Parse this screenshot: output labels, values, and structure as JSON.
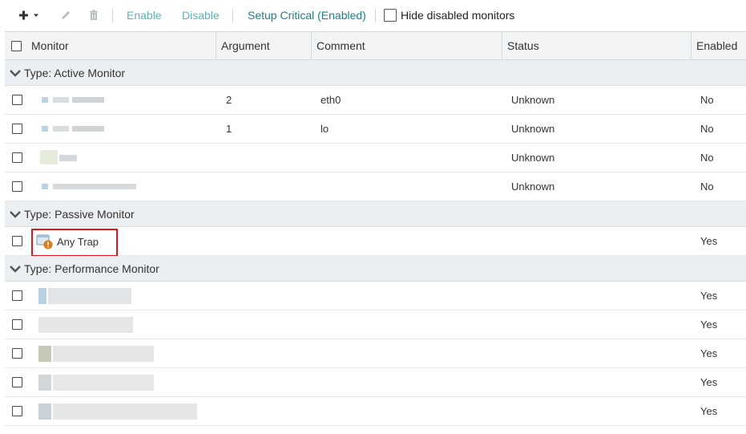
{
  "toolbar": {
    "add_icon": "plus-icon",
    "dropdown_icon": "caret-down-icon",
    "edit_icon": "pencil-icon",
    "delete_icon": "trash-icon",
    "enable_label": "Enable",
    "disable_label": "Disable",
    "setup_critical_label": "Setup Critical (Enabled)",
    "hide_disabled_label": "Hide disabled monitors",
    "hide_disabled_checked": false
  },
  "columns": {
    "monitor": "Monitor",
    "argument": "Argument",
    "comment": "Comment",
    "status": "Status",
    "enabled": "Enabled"
  },
  "groups": [
    {
      "label": "Type: Active Monitor",
      "rows": [
        {
          "name": "",
          "argument": "2",
          "comment": "eth0",
          "status": "Unknown",
          "enabled": "No"
        },
        {
          "name": "",
          "argument": "1",
          "comment": "lo",
          "status": "Unknown",
          "enabled": "No"
        },
        {
          "name": "",
          "argument": "",
          "comment": "",
          "status": "Unknown",
          "enabled": "No"
        },
        {
          "name": "",
          "argument": "",
          "comment": "",
          "status": "Unknown",
          "enabled": "No"
        }
      ]
    },
    {
      "label": "Type: Passive Monitor",
      "rows": [
        {
          "name": "Any Trap",
          "icon": "snmp-trap-warning-icon",
          "argument": "",
          "comment": "",
          "status": "",
          "enabled": "Yes"
        }
      ]
    },
    {
      "label": "Type: Performance Monitor",
      "rows": [
        {
          "name": "",
          "argument": "",
          "comment": "",
          "status": "",
          "enabled": "Yes"
        },
        {
          "name": "",
          "argument": "",
          "comment": "",
          "status": "",
          "enabled": "Yes"
        },
        {
          "name": "",
          "argument": "",
          "comment": "",
          "status": "",
          "enabled": "Yes"
        },
        {
          "name": "",
          "argument": "",
          "comment": "",
          "status": "",
          "enabled": "Yes"
        },
        {
          "name": "",
          "argument": "",
          "comment": "",
          "status": "",
          "enabled": "Yes"
        }
      ]
    }
  ],
  "colors": {
    "link_active": "#1b7f8a",
    "link_muted": "#5ab3bd",
    "highlight_border": "#e0161b",
    "header_bg": "#f2f4f5",
    "group_bg": "#eceff1"
  }
}
